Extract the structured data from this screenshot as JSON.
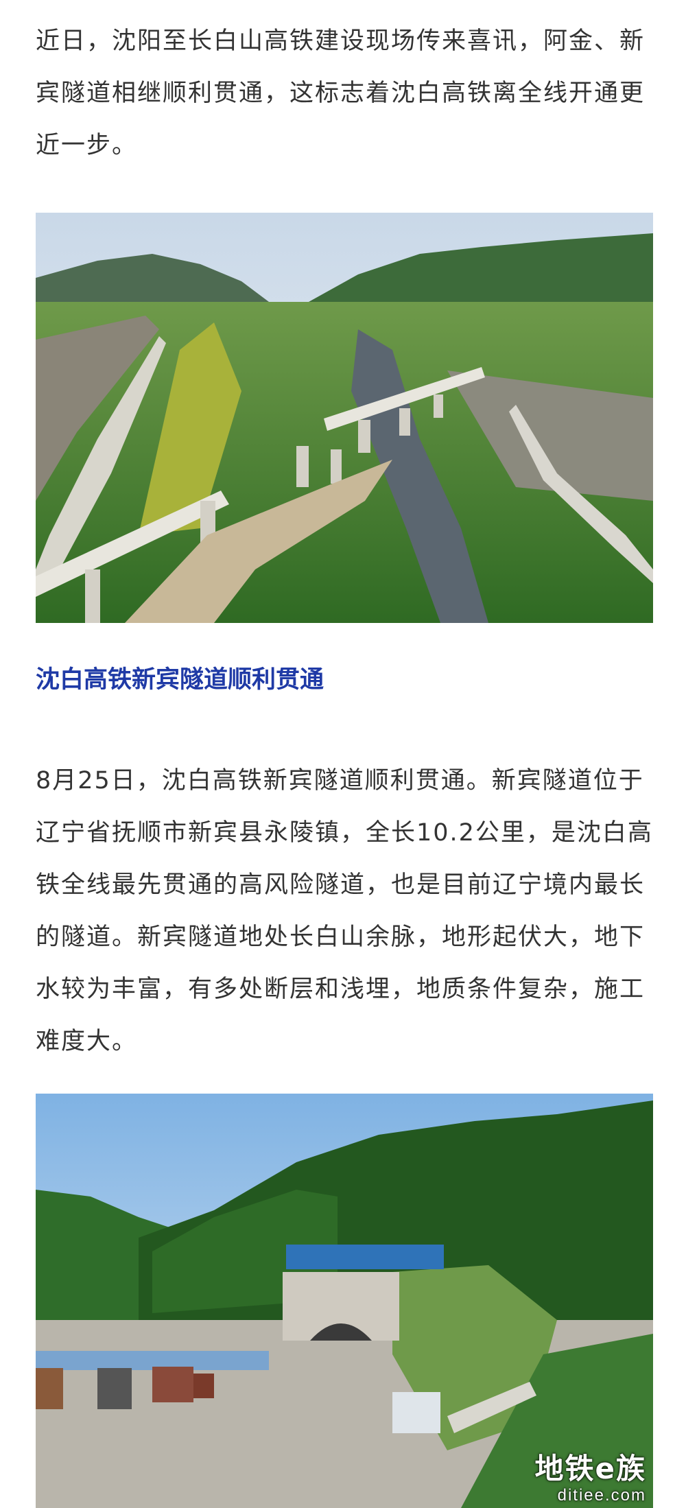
{
  "article": {
    "intro": "近日，沈阳至长白山高铁建设现场传来喜讯，阿金、新宾隧道相继顺利贯通，这标志着沈白高铁离全线开通更近一步。",
    "section_heading": "沈白高铁新宾隧道顺利贯通",
    "body": "8月25日，沈白高铁新宾隧道顺利贯通。新宾隧道位于辽宁省抚顺市新宾县永陵镇，全长10.2公里，是沈白高铁全线最先贯通的高风险隧道，也是目前辽宁境内最长的隧道。新宾隧道地处长白山余脉，地形起伏大，地下水较为丰富，有多处断层和浅埋，地质条件复杂，施工难度大。"
  },
  "watermark": {
    "main": "地铁e族",
    "sub": "ditiee.com"
  },
  "colors": {
    "heading": "#1f3aa6",
    "body_text": "#333333"
  }
}
